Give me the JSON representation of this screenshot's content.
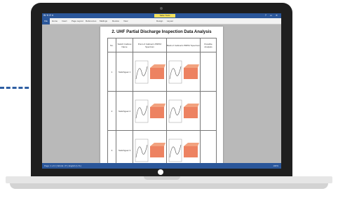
{
  "word": {
    "title_left": "W ⟲ ⟳ ▾",
    "contextual_tab": "Table Tools",
    "window_controls": "? ▭ ✕",
    "file_tab": "File",
    "ribbon_tabs": [
      "Home",
      "Insert",
      "Page Layout",
      "References",
      "Mailings",
      "Review",
      "View",
      "Design",
      "Layout"
    ],
    "status_left": "Page: 1 of 4 | Words: 37 | English (U.S.)",
    "status_right": "100%"
  },
  "document": {
    "title": "2. UHF Partial Discharge Inspection Data Analysis",
    "headers": [
      "No.",
      "Switch Cabinet Name",
      "Point of Cabinet's PRPD/ Spectrum",
      "Back of Cabinet's PRPD/ Spectrum",
      "Possible Analysis"
    ],
    "rows": [
      {
        "no": "1",
        "name": "Switchgear 1"
      },
      {
        "no": "2",
        "name": "Switchgear 2"
      },
      {
        "no": "3",
        "name": "Switchgear 3"
      }
    ]
  },
  "colors": {
    "accent": "#2b579a",
    "data_orange": "#e8633a",
    "dash": "#2f5fa3"
  }
}
